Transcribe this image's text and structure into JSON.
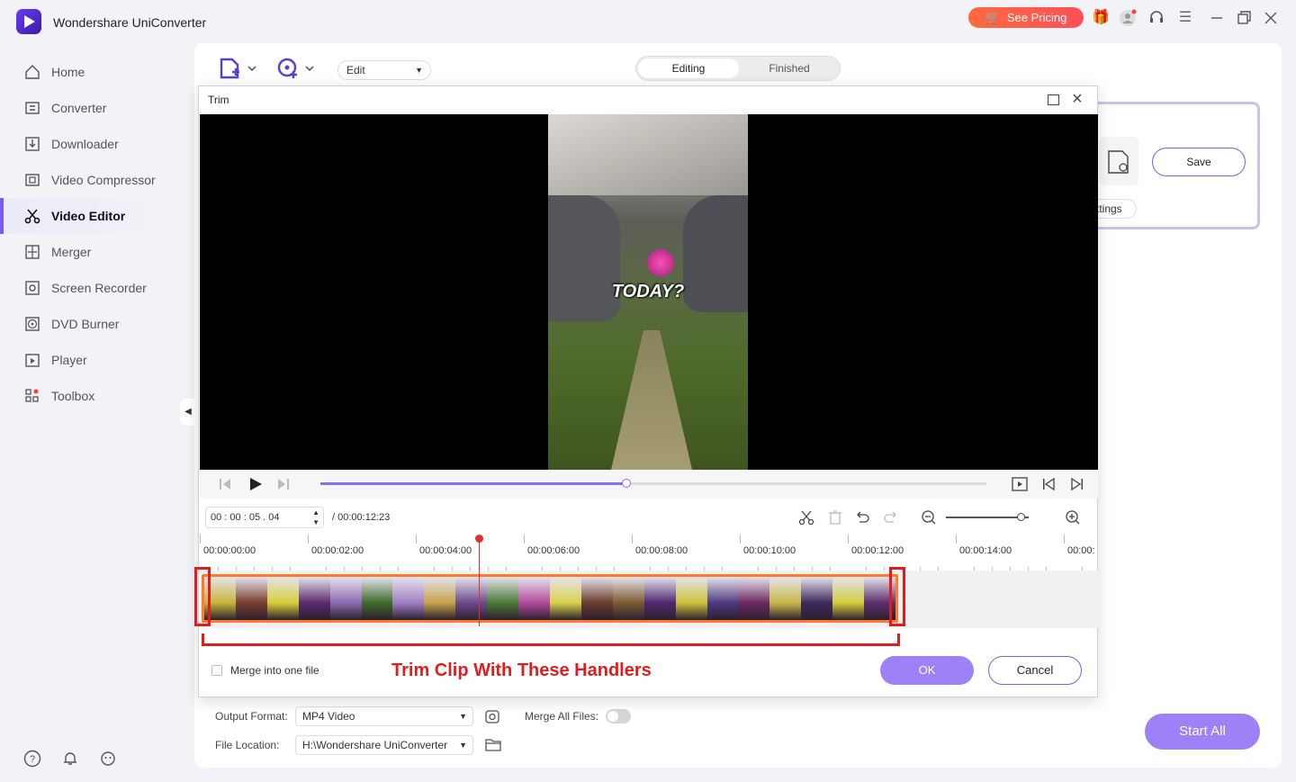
{
  "app": {
    "title": "Wondershare UniConverter",
    "pricing_label": "See Pricing",
    "accent": "#7b5cf0"
  },
  "sidebar": {
    "items": [
      {
        "label": "Home",
        "icon": "home-icon"
      },
      {
        "label": "Converter",
        "icon": "converter-icon"
      },
      {
        "label": "Downloader",
        "icon": "downloader-icon"
      },
      {
        "label": "Video Compressor",
        "icon": "compress-icon"
      },
      {
        "label": "Video Editor",
        "icon": "scissors-icon",
        "active": true
      },
      {
        "label": "Merger",
        "icon": "merger-icon"
      },
      {
        "label": "Screen Recorder",
        "icon": "record-icon"
      },
      {
        "label": "DVD Burner",
        "icon": "disc-icon"
      },
      {
        "label": "Player",
        "icon": "player-icon"
      },
      {
        "label": "Toolbox",
        "icon": "toolbox-icon"
      }
    ]
  },
  "toolbar": {
    "edit_select": "Edit",
    "tab_editing": "Editing",
    "tab_finished": "Finished"
  },
  "right_card": {
    "save_label": "Save",
    "settings_label": "ttings"
  },
  "output": {
    "format_label": "Output Format:",
    "format_value": "MP4 Video",
    "merge_all_label": "Merge All Files:",
    "location_label": "File Location:",
    "location_value": "H:\\Wondershare UniConverter",
    "start_all_label": "Start All"
  },
  "trim": {
    "title": "Trim",
    "video_overlay_text": "TODAY?",
    "progress": 0.46,
    "time": {
      "h": "00",
      "m": "00",
      "s": "05",
      "f": "04"
    },
    "duration": "/ 00:00:12:23",
    "zoom": 0.9,
    "ruler": [
      "00:00:00:00",
      "00:00:02:00",
      "00:00:04:00",
      "00:00:06:00",
      "00:00:08:00",
      "00:00:10:00",
      "00:00:12:00",
      "00:00:14:00",
      "00:00:"
    ],
    "merge_label": "Merge into one file",
    "annotation": "Trim Clip With These Handlers",
    "ok_label": "OK",
    "cancel_label": "Cancel"
  }
}
